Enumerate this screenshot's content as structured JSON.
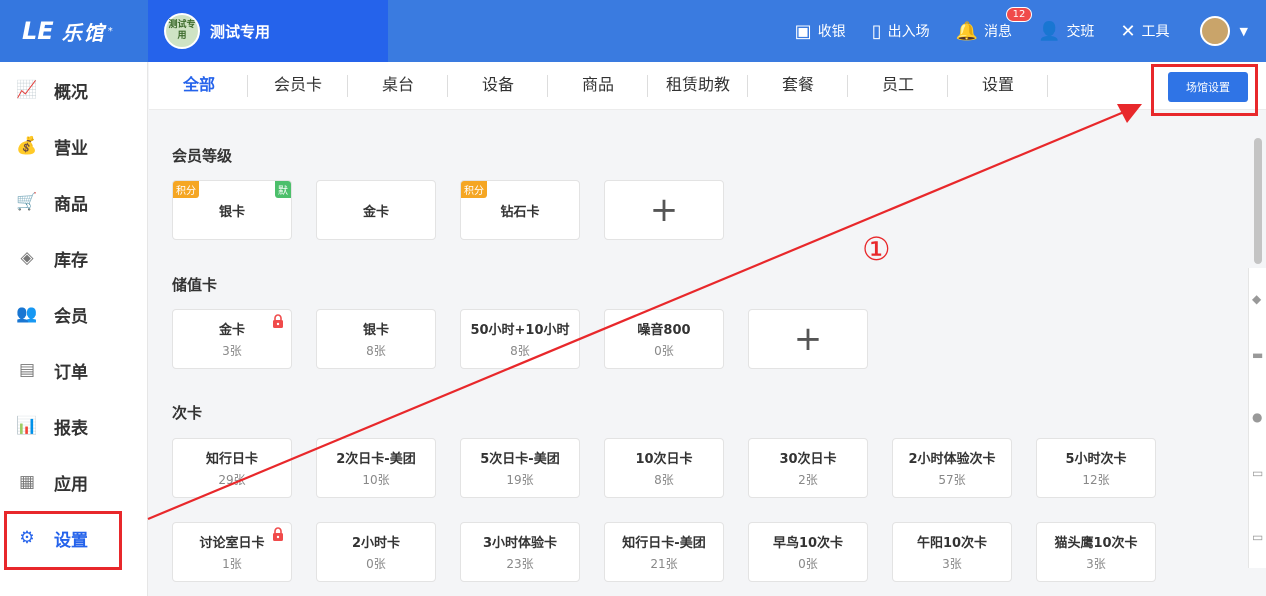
{
  "header": {
    "logo_mark": "LE",
    "logo_text": "乐馆",
    "logo_star": "*",
    "venue_avatar_text": "测试专用",
    "venue_name": "测试专用",
    "actions": [
      {
        "label": "收银",
        "icon": "cashier-icon"
      },
      {
        "label": "出入场",
        "icon": "door-icon"
      },
      {
        "label": "消息",
        "icon": "bell-icon",
        "badge": "12"
      },
      {
        "label": "交班",
        "icon": "handover-icon"
      },
      {
        "label": "工具",
        "icon": "tools-icon"
      }
    ]
  },
  "sidebar": {
    "items": [
      {
        "label": "概况",
        "icon": "chart-line-icon"
      },
      {
        "label": "营业",
        "icon": "money-bag-icon"
      },
      {
        "label": "商品",
        "icon": "cart-icon"
      },
      {
        "label": "库存",
        "icon": "layers-icon"
      },
      {
        "label": "会员",
        "icon": "users-icon"
      },
      {
        "label": "订单",
        "icon": "order-icon"
      },
      {
        "label": "报表",
        "icon": "bar-chart-icon"
      },
      {
        "label": "应用",
        "icon": "apps-icon"
      },
      {
        "label": "设置",
        "icon": "gear-icon",
        "active": true
      }
    ]
  },
  "tabs": [
    "全部",
    "会员卡",
    "桌台",
    "设备",
    "商品",
    "租赁助教",
    "套餐",
    "员工",
    "设置"
  ],
  "active_tab": "全部",
  "venue_settings_button": "场馆设置",
  "sections": {
    "member_levels": {
      "title": "会员等级",
      "cards": [
        {
          "name": "银卡",
          "tags": [
            "积分",
            "默"
          ]
        },
        {
          "name": "金卡",
          "tags": []
        },
        {
          "name": "钻石卡",
          "tags": [
            "积分"
          ]
        }
      ]
    },
    "stored_value": {
      "title": "储值卡",
      "cards": [
        {
          "name": "金卡",
          "count": "3张",
          "locked": true
        },
        {
          "name": "银卡",
          "count": "8张"
        },
        {
          "name": "50小时+10小时",
          "count": "8张"
        },
        {
          "name": "噪音800",
          "count": "0张"
        }
      ]
    },
    "times_cards": {
      "title": "次卡",
      "row1": [
        {
          "name": "知行日卡",
          "count": "29张"
        },
        {
          "name": "2次日卡-美团",
          "count": "10张"
        },
        {
          "name": "5次日卡-美团",
          "count": "19张"
        },
        {
          "name": "10次日卡",
          "count": "8张"
        },
        {
          "name": "30次日卡",
          "count": "2张"
        },
        {
          "name": "2小时体验次卡",
          "count": "57张"
        },
        {
          "name": "5小时次卡",
          "count": "12张"
        }
      ],
      "row2": [
        {
          "name": "讨论室日卡",
          "count": "1张",
          "locked": true
        },
        {
          "name": "2小时卡",
          "count": "0张"
        },
        {
          "name": "3小时体验卡",
          "count": "23张"
        },
        {
          "name": "知行日卡-美团",
          "count": "21张"
        },
        {
          "name": "早鸟10次卡",
          "count": "0张"
        },
        {
          "name": "午阳10次卡",
          "count": "3张"
        },
        {
          "name": "猫头鹰10次卡",
          "count": "3张"
        }
      ]
    }
  },
  "add_symbol": "+",
  "annotation_marker": "①",
  "colors": {
    "primary": "#2563eb",
    "highlight": "#e8282b"
  }
}
